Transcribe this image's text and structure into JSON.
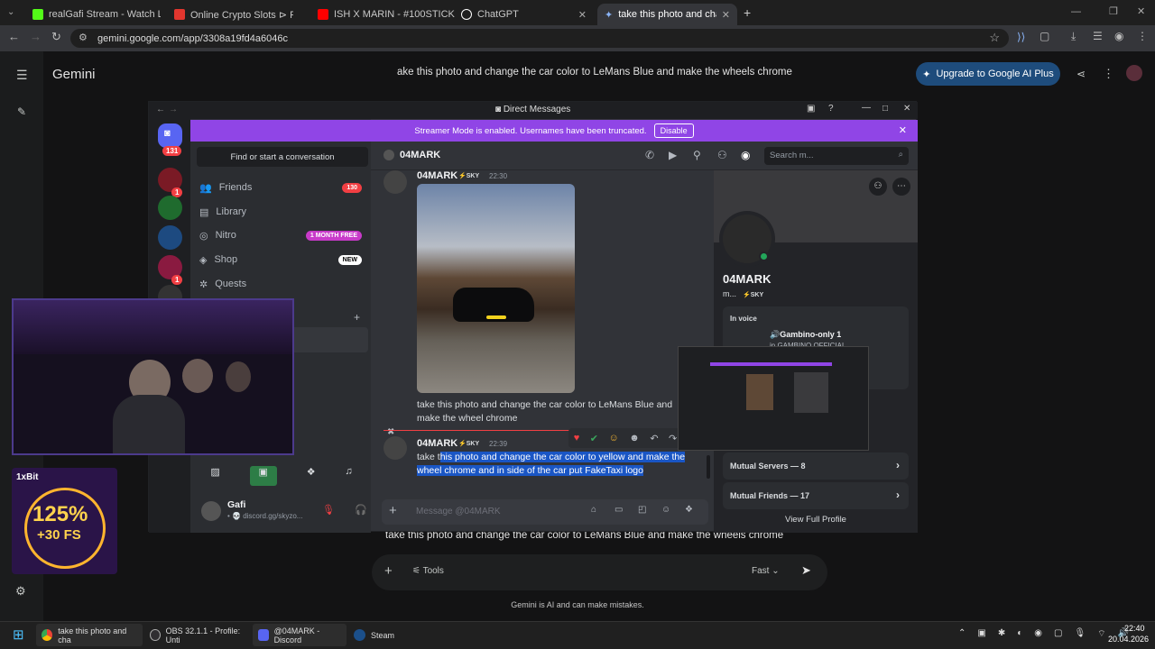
{
  "browser": {
    "tabs": [
      {
        "title": "realGafi Stream - Watch Live on",
        "fav": "#53fc18"
      },
      {
        "title": "Online Crypto Slots ⊳ Play",
        "fav": "#e2362e"
      },
      {
        "title": "ISH X MARIN - #100STICKS (P",
        "fav": "#ff0000"
      },
      {
        "title": "ChatGPT",
        "fav": "#ffffff"
      },
      {
        "title": "take this photo and change the",
        "fav": "#4f8df5"
      }
    ],
    "url": "gemini.google.com/app/3308a19fd4a6046c"
  },
  "gemini": {
    "title": "Gemini",
    "prompt": "ake this photo and change the car color to LeMans Blue and make the wheels chrome",
    "upgrade_label": "Upgrade to Google AI Plus",
    "response": "take this photo and change the car color to LeMans Blue and make the wheels chrome",
    "tools_label": "Tools",
    "mode_label": "Fast",
    "footer": "Gemini is AI and can make mistakes."
  },
  "discord": {
    "window_title": "Direct Messages",
    "banner_text": "Streamer Mode is enabled. Usernames have been truncated.",
    "banner_button": "Disable",
    "home_badge": "131",
    "server_badges": [
      "1",
      "1"
    ],
    "search_conv": "Find or start a conversation",
    "nav": [
      {
        "label": "Friends",
        "badge": "130"
      },
      {
        "label": "Library",
        "badge": ""
      },
      {
        "label": "Nitro",
        "badge": "1 MONTH FREE"
      },
      {
        "label": "Shop",
        "badge": "NEW"
      },
      {
        "label": "Quests",
        "badge": ""
      }
    ],
    "user": {
      "name": "Gafi",
      "status": "• 💀 discord.gg/skyzo..."
    },
    "chat_user": "04MARK",
    "search_placeholder": "Search m...",
    "messages": [
      {
        "author": "04MARK",
        "tag": "⚡SKY",
        "time": "22:30",
        "text": "take this photo and change the car color to LeMans Blue and make the wheel chrome"
      },
      {
        "author": "04MARK",
        "tag": "⚡SKY",
        "time": "22:39",
        "text_pre": "take t",
        "text_sel": "his photo and change the car color to yellow and make the wheel chrome and in side of the car put FakeTaxi logo"
      }
    ],
    "message_placeholder": "Message @04MARK",
    "profile": {
      "name": "04MARK",
      "sub": "m...",
      "tag": "⚡SKY",
      "in_voice": "In voice",
      "voice_channel": "🔊Gambino-only 1",
      "voice_server": "in GAMBINO OFFICIAL",
      "mutual_servers": "Mutual Servers — 8",
      "mutual_friends": "Mutual Friends — 17",
      "view_full": "View Full Profile"
    }
  },
  "promo": {
    "brand": "1xBit",
    "line1": "125%",
    "line2": "+30 FS"
  },
  "taskbar": {
    "items": [
      {
        "label": "take this photo and cha"
      },
      {
        "label": "OBS 32.1.1 - Profile: Unti"
      },
      {
        "label": "@04MARK - Discord"
      },
      {
        "label": "Steam"
      }
    ],
    "time": "22:40",
    "date": "20.04.2026"
  }
}
